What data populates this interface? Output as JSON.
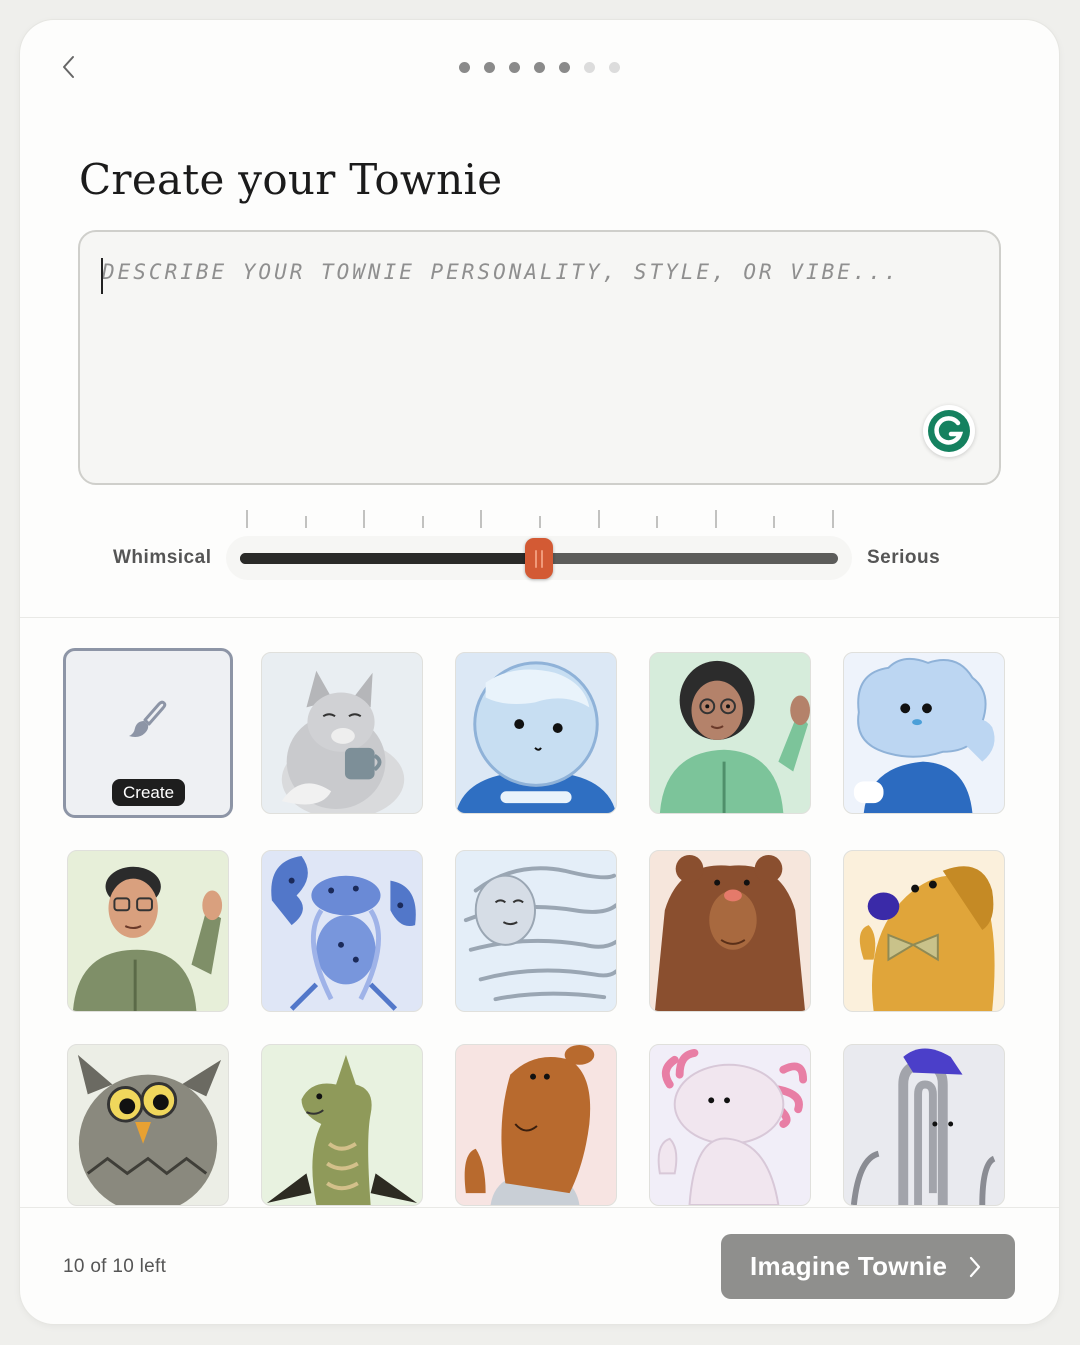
{
  "header": {
    "back_icon": "chevron-left-icon",
    "progress": {
      "total_steps": 7,
      "completed_steps": 5
    }
  },
  "main": {
    "title": "Create your Townie",
    "description": {
      "placeholder": "Describe your Townie personality, style, or vibe...",
      "value": "",
      "assistant_icon": "grammarly-icon"
    },
    "tone_slider": {
      "left_label": "Whimsical",
      "right_label": "Serious",
      "value": 0.5,
      "tick_count": 11
    }
  },
  "gallery": {
    "create_tile": {
      "label": "Create",
      "icon": "paintbrush-icon"
    },
    "avatars": [
      {
        "name": "fox-with-mug"
      },
      {
        "name": "snowball-character"
      },
      {
        "name": "woman-green-hoodie-waving"
      },
      {
        "name": "cloud-character-waving"
      },
      {
        "name": "man-olive-hoodie-waving"
      },
      {
        "name": "blue-lobster"
      },
      {
        "name": "wind-spirit"
      },
      {
        "name": "brown-bear"
      },
      {
        "name": "yellow-dog-bowtie"
      },
      {
        "name": "owl"
      },
      {
        "name": "green-dragon"
      },
      {
        "name": "capybara-waving"
      },
      {
        "name": "pink-axolotl"
      },
      {
        "name": "paperclip-with-cap"
      }
    ]
  },
  "footer": {
    "remaining": "10 of 10 left",
    "submit_label": "Imagine Townie",
    "submit_icon": "chevron-right-icon"
  },
  "colors": {
    "accent": "#d35a34",
    "button_disabled": "#8f8f8d",
    "card_bg": "#fdfdfc"
  }
}
